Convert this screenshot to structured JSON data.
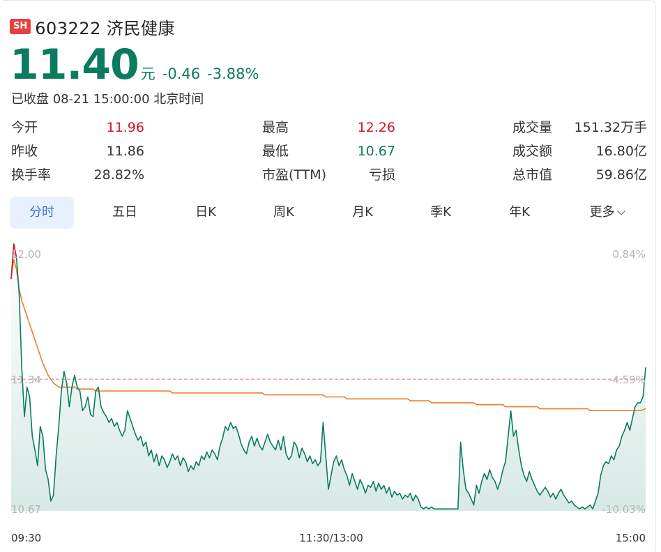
{
  "header": {
    "exchange_badge": "SH",
    "stock_name": "603222 济民健康"
  },
  "quote": {
    "price": "11.40",
    "unit": "元",
    "change": "-0.46",
    "change_pct": "-3.88%",
    "status": "已收盘 08-21 15:00:00 北京时间"
  },
  "stats": [
    [
      {
        "label": "今开",
        "value": "11.96",
        "tone": "red"
      },
      {
        "label": "最高",
        "value": "12.26",
        "tone": "red"
      },
      {
        "label": "成交量",
        "value": "151.32万手",
        "tone": "plain"
      }
    ],
    [
      {
        "label": "昨收",
        "value": "11.86",
        "tone": "plain"
      },
      {
        "label": "最低",
        "value": "10.67",
        "tone": "green"
      },
      {
        "label": "成交额",
        "value": "16.80亿",
        "tone": "plain"
      }
    ],
    [
      {
        "label": "换手率",
        "value": "28.82%",
        "tone": "plain"
      },
      {
        "label": "市盈(TTM)",
        "value": "亏损",
        "tone": "plain"
      },
      {
        "label": "总市值",
        "value": "59.86亿",
        "tone": "plain"
      }
    ]
  ],
  "tabs": [
    {
      "label": "分时",
      "active": true
    },
    {
      "label": "五日",
      "active": false
    },
    {
      "label": "日K",
      "active": false
    },
    {
      "label": "周K",
      "active": false
    },
    {
      "label": "月K",
      "active": false
    },
    {
      "label": "季K",
      "active": false
    },
    {
      "label": "年K",
      "active": false
    },
    {
      "label": "更多",
      "active": false,
      "has_dropdown": true
    }
  ],
  "colors": {
    "down": "#0b7b60",
    "up": "#d0142a",
    "avg_line": "#ea7d2a",
    "ref_line": "#e98d8d",
    "axis_text": "#b3b3b3",
    "active_tab_bg": "#e8f1fd",
    "active_tab_text": "#3a72d8"
  },
  "chart_data": {
    "type": "line",
    "price_axis": {
      "top": "12.00",
      "mid": "11.34",
      "bottom": "10.67"
    },
    "pct_axis": {
      "top": "0.84%",
      "mid": "-4.59%",
      "bottom": "-10.03%"
    },
    "time_labels": [
      "09:30",
      "11:30/13:00",
      "15:00"
    ],
    "ylim": [
      10.67,
      12.0
    ],
    "reference_price": 11.34,
    "n_points": 241,
    "series": [
      {
        "role": "price",
        "points": [
          [
            0,
            11.85
          ],
          [
            1,
            12.03
          ],
          [
            2,
            11.96
          ],
          [
            3,
            11.78
          ],
          [
            4,
            11.4
          ],
          [
            5,
            11.15
          ],
          [
            6,
            11.3
          ],
          [
            7,
            11.25
          ],
          [
            8,
            11.05
          ],
          [
            9,
            10.98
          ],
          [
            10,
            10.9
          ],
          [
            11,
            11.1
          ],
          [
            12,
            11.05
          ],
          [
            13,
            10.88
          ],
          [
            14,
            10.83
          ],
          [
            15,
            10.72
          ],
          [
            16,
            10.75
          ],
          [
            17,
            10.95
          ],
          [
            18,
            11.1
          ],
          [
            19,
            11.28
          ],
          [
            20,
            11.38
          ],
          [
            21,
            11.32
          ],
          [
            22,
            11.2
          ],
          [
            23,
            11.3
          ],
          [
            24,
            11.36
          ],
          [
            25,
            11.3
          ],
          [
            26,
            11.28
          ],
          [
            27,
            11.18
          ],
          [
            28,
            11.2
          ],
          [
            29,
            11.25
          ],
          [
            30,
            11.16
          ],
          [
            31,
            11.15
          ],
          [
            32,
            11.28
          ],
          [
            33,
            11.3
          ],
          [
            34,
            11.2
          ],
          [
            35,
            11.17
          ],
          [
            36,
            11.15
          ],
          [
            37,
            11.12
          ],
          [
            38,
            11.14
          ],
          [
            39,
            11.1
          ],
          [
            40,
            11.12
          ],
          [
            41,
            11.08
          ],
          [
            42,
            11.05
          ],
          [
            43,
            11.08
          ],
          [
            44,
            11.18
          ],
          [
            45,
            11.14
          ],
          [
            46,
            11.1
          ],
          [
            47,
            11.06
          ],
          [
            48,
            11.03
          ],
          [
            49,
            11.05
          ],
          [
            50,
            11.0
          ],
          [
            51,
            11.02
          ],
          [
            52,
            10.95
          ],
          [
            53,
            10.98
          ],
          [
            54,
            10.92
          ],
          [
            55,
            10.96
          ],
          [
            56,
            10.9
          ],
          [
            57,
            10.95
          ],
          [
            58,
            10.93
          ],
          [
            59,
            10.89
          ],
          [
            60,
            10.92
          ],
          [
            61,
            10.96
          ],
          [
            62,
            10.93
          ],
          [
            63,
            10.95
          ],
          [
            64,
            10.9
          ],
          [
            65,
            10.94
          ],
          [
            66,
            10.92
          ],
          [
            67,
            10.87
          ],
          [
            68,
            10.9
          ],
          [
            69,
            10.88
          ],
          [
            70,
            10.92
          ],
          [
            71,
            10.9
          ],
          [
            72,
            10.95
          ],
          [
            73,
            10.93
          ],
          [
            74,
            10.97
          ],
          [
            75,
            10.94
          ],
          [
            76,
            10.98
          ],
          [
            77,
            10.96
          ],
          [
            78,
            10.93
          ],
          [
            79,
            11.0
          ],
          [
            80,
            11.04
          ],
          [
            81,
            11.1
          ],
          [
            82,
            11.08
          ],
          [
            83,
            11.12
          ],
          [
            84,
            11.09
          ],
          [
            85,
            11.1
          ],
          [
            86,
            11.06
          ],
          [
            87,
            11.01
          ],
          [
            88,
            10.98
          ],
          [
            89,
            10.96
          ],
          [
            90,
            11.02
          ],
          [
            91,
            11.05
          ],
          [
            92,
            11.0
          ],
          [
            93,
            11.04
          ],
          [
            94,
            11.0
          ],
          [
            95,
            10.98
          ],
          [
            96,
            11.02
          ],
          [
            97,
            11.06
          ],
          [
            98,
            11.02
          ],
          [
            99,
            11.0
          ],
          [
            100,
            10.98
          ],
          [
            101,
            11.03
          ],
          [
            102,
            10.98
          ],
          [
            103,
            11.05
          ],
          [
            104,
            10.96
          ],
          [
            105,
            10.93
          ],
          [
            106,
            10.95
          ],
          [
            107,
            11.02
          ],
          [
            108,
            11.0
          ],
          [
            109,
            10.94
          ],
          [
            110,
            10.99
          ],
          [
            111,
            10.96
          ],
          [
            112,
            10.92
          ],
          [
            113,
            10.95
          ],
          [
            114,
            10.91
          ],
          [
            115,
            10.93
          ],
          [
            116,
            10.9
          ],
          [
            117,
            10.92
          ],
          [
            118,
            11.12
          ],
          [
            119,
            10.95
          ],
          [
            120,
            10.78
          ],
          [
            121,
            10.85
          ],
          [
            122,
            10.92
          ],
          [
            123,
            10.95
          ],
          [
            124,
            10.9
          ],
          [
            125,
            10.93
          ],
          [
            126,
            10.88
          ],
          [
            127,
            10.85
          ],
          [
            128,
            10.8
          ],
          [
            129,
            10.86
          ],
          [
            130,
            10.82
          ],
          [
            131,
            10.78
          ],
          [
            132,
            10.83
          ],
          [
            133,
            10.8
          ],
          [
            134,
            10.76
          ],
          [
            135,
            10.8
          ],
          [
            136,
            10.79
          ],
          [
            137,
            10.82
          ],
          [
            138,
            10.77
          ],
          [
            139,
            10.81
          ],
          [
            140,
            10.78
          ],
          [
            141,
            10.8
          ],
          [
            142,
            10.76
          ],
          [
            143,
            10.79
          ],
          [
            144,
            10.74
          ],
          [
            145,
            10.77
          ],
          [
            146,
            10.75
          ],
          [
            147,
            10.76
          ],
          [
            148,
            10.73
          ],
          [
            149,
            10.75
          ],
          [
            150,
            10.74
          ],
          [
            151,
            10.76
          ],
          [
            152,
            10.72
          ],
          [
            153,
            10.75
          ],
          [
            154,
            10.73
          ],
          [
            155,
            10.69
          ],
          [
            156,
            10.68
          ],
          [
            157,
            10.69
          ],
          [
            158,
            10.68
          ],
          [
            159,
            10.69
          ],
          [
            160,
            10.68
          ],
          [
            161,
            10.68
          ],
          [
            162,
            10.68
          ],
          [
            163,
            10.68
          ],
          [
            164,
            10.68
          ],
          [
            165,
            10.68
          ],
          [
            166,
            10.68
          ],
          [
            167,
            10.68
          ],
          [
            168,
            10.68
          ],
          [
            169,
            10.68
          ],
          [
            170,
            11.02
          ],
          [
            171,
            10.88
          ],
          [
            172,
            10.78
          ],
          [
            173,
            10.76
          ],
          [
            174,
            10.73
          ],
          [
            175,
            10.7
          ],
          [
            176,
            10.8
          ],
          [
            177,
            10.76
          ],
          [
            178,
            10.82
          ],
          [
            179,
            10.86
          ],
          [
            180,
            10.83
          ],
          [
            181,
            10.88
          ],
          [
            182,
            10.84
          ],
          [
            183,
            10.82
          ],
          [
            184,
            10.78
          ],
          [
            185,
            10.82
          ],
          [
            186,
            10.88
          ],
          [
            187,
            10.92
          ],
          [
            188,
            11.05
          ],
          [
            189,
            11.18
          ],
          [
            190,
            11.05
          ],
          [
            191,
            11.08
          ],
          [
            192,
            10.98
          ],
          [
            193,
            10.9
          ],
          [
            194,
            10.85
          ],
          [
            195,
            10.82
          ],
          [
            196,
            10.87
          ],
          [
            197,
            10.83
          ],
          [
            198,
            10.8
          ],
          [
            199,
            10.77
          ],
          [
            200,
            10.75
          ],
          [
            201,
            10.77
          ],
          [
            202,
            10.79
          ],
          [
            203,
            10.77
          ],
          [
            204,
            10.74
          ],
          [
            205,
            10.76
          ],
          [
            206,
            10.73
          ],
          [
            207,
            10.76
          ],
          [
            208,
            10.78
          ],
          [
            209,
            10.75
          ],
          [
            210,
            10.73
          ],
          [
            211,
            10.71
          ],
          [
            212,
            10.72
          ],
          [
            213,
            10.7
          ],
          [
            214,
            10.69
          ],
          [
            215,
            10.68
          ],
          [
            216,
            10.69
          ],
          [
            217,
            10.68
          ],
          [
            218,
            10.69
          ],
          [
            219,
            10.7
          ],
          [
            220,
            10.68
          ],
          [
            221,
            10.72
          ],
          [
            222,
            10.76
          ],
          [
            223,
            10.85
          ],
          [
            224,
            10.9
          ],
          [
            225,
            10.92
          ],
          [
            226,
            10.91
          ],
          [
            227,
            10.95
          ],
          [
            228,
            10.93
          ],
          [
            229,
            10.98
          ],
          [
            230,
            11.0
          ],
          [
            231,
            11.05
          ],
          [
            232,
            11.08
          ],
          [
            233,
            11.12
          ],
          [
            234,
            11.08
          ],
          [
            235,
            11.14
          ],
          [
            236,
            11.2
          ],
          [
            237,
            11.22
          ],
          [
            238,
            11.22
          ],
          [
            239,
            11.25
          ],
          [
            240,
            11.4
          ]
        ]
      },
      {
        "role": "average",
        "points": [
          [
            0,
            11.86
          ],
          [
            1,
            11.95
          ],
          [
            2,
            11.9
          ],
          [
            3,
            11.8
          ],
          [
            4,
            11.74
          ],
          [
            5,
            11.7
          ],
          [
            6,
            11.66
          ],
          [
            7,
            11.62
          ],
          [
            8,
            11.58
          ],
          [
            9,
            11.54
          ],
          [
            10,
            11.5
          ],
          [
            11,
            11.46
          ],
          [
            12,
            11.42
          ],
          [
            13,
            11.39
          ],
          [
            14,
            11.36
          ],
          [
            15,
            11.34
          ],
          [
            16,
            11.32
          ],
          [
            17,
            11.31
          ],
          [
            18,
            11.3
          ],
          [
            19,
            11.3
          ],
          [
            20,
            11.3
          ],
          [
            24,
            11.3
          ],
          [
            25,
            11.29
          ],
          [
            31,
            11.29
          ],
          [
            32,
            11.28
          ],
          [
            60,
            11.28
          ],
          [
            61,
            11.27
          ],
          [
            95,
            11.27
          ],
          [
            96,
            11.26
          ],
          [
            118,
            11.26
          ],
          [
            119,
            11.25
          ],
          [
            126,
            11.25
          ],
          [
            127,
            11.24
          ],
          [
            150,
            11.24
          ],
          [
            151,
            11.23
          ],
          [
            158,
            11.23
          ],
          [
            159,
            11.22
          ],
          [
            175,
            11.22
          ],
          [
            176,
            11.21
          ],
          [
            186,
            11.21
          ],
          [
            187,
            11.2
          ],
          [
            199,
            11.2
          ],
          [
            200,
            11.19
          ],
          [
            218,
            11.19
          ],
          [
            219,
            11.18
          ],
          [
            238,
            11.18
          ],
          [
            240,
            11.19
          ]
        ]
      }
    ]
  }
}
